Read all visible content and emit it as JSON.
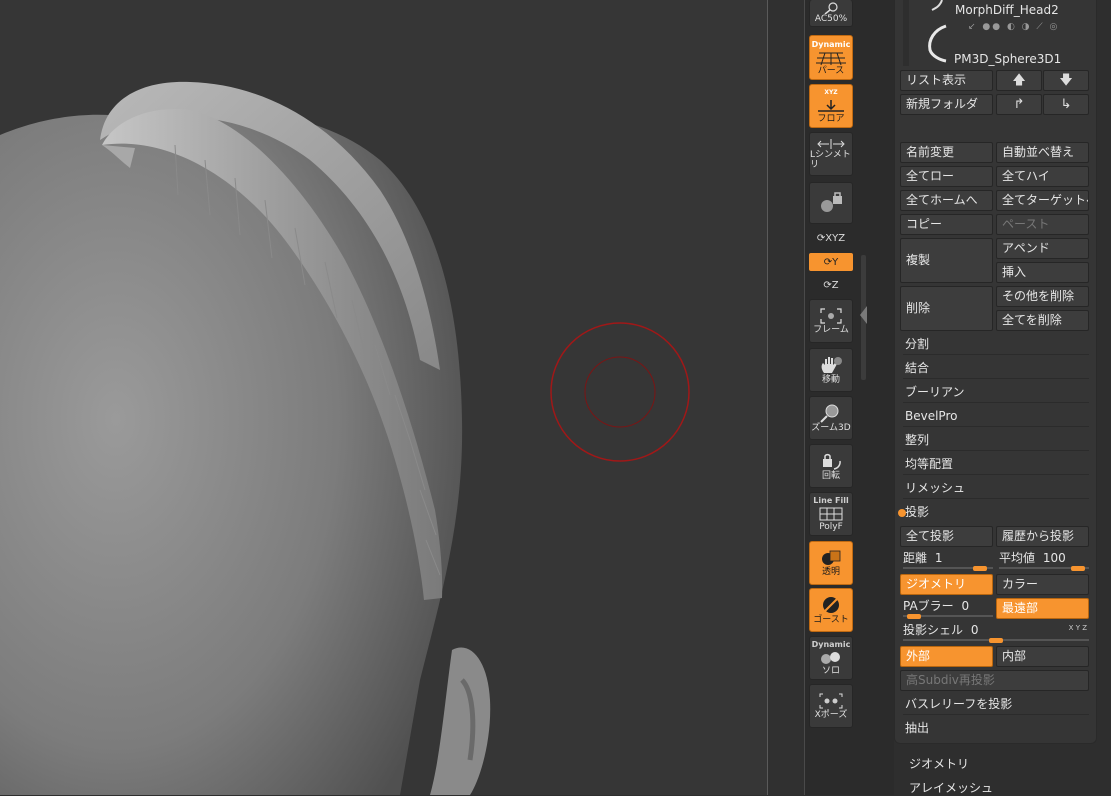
{
  "toolbar": {
    "ac_label": "AC50%",
    "persp_top": "Dynamic",
    "persp_label": "パース",
    "floor_top": "XYZ",
    "floor_label": "フロア",
    "symmetry_label": "Lシンメトリ",
    "xyz_label": "XYZ",
    "y_label": "Y",
    "z_label": "Z",
    "frame_label": "フレーム",
    "move_label": "移動",
    "zoom_label": "ズーム3D",
    "rotate_label": "回転",
    "polyf_top": "Line Fill",
    "polyf_label": "PolyF",
    "transp_label": "透明",
    "ghost_label": "ゴースト",
    "solo_top": "Dynamic",
    "solo_label": "ソロ",
    "xpose_label": "Xポーズ"
  },
  "subtools": {
    "item1": "MorphDiff_Head2",
    "item2": "PM3D_Sphere3D1"
  },
  "palette": {
    "list_view": "リスト表示",
    "new_folder": "新規フォルダ",
    "rename": "名前変更",
    "auto_sort": "自動並べ替え",
    "all_low": "全てロー",
    "all_high": "全てハイ",
    "all_home": "全てホームへ",
    "all_target": "全てターゲットへ",
    "copy": "コピー",
    "paste": "ペースト",
    "duplicate": "複製",
    "append": "アペンド",
    "insert": "挿入",
    "delete": "削除",
    "delete_other": "その他を削除",
    "delete_all": "全てを削除",
    "split": "分割",
    "merge": "結合",
    "boolean": "ブーリアン",
    "bevelpro": "BevelPro",
    "align": "整列",
    "distribute": "均等配置",
    "remesh": "リメッシュ",
    "project": "投影",
    "project_all": "全て投影",
    "project_history": "履歴から投影",
    "distance_label": "距離",
    "distance_value": "1",
    "distance_fraction": 0.92,
    "mean_label": "平均値",
    "mean_value": "100",
    "mean_fraction": 0.95,
    "geometry": "ジオメトリ",
    "color": "カラー",
    "pa_blur_label": "PAブラー",
    "pa_blur_value": "0",
    "pa_blur_fraction": 0.05,
    "farthest": "最遠部",
    "proj_shell_label": "投影シェル",
    "proj_shell_value": "0",
    "proj_shell_fraction": 0.5,
    "xyz_tag": "X Y Z",
    "outer": "外部",
    "inner": "内部",
    "high_subdiv": "高Subdiv再投影",
    "project_basrelief": "バスレリーフを投影",
    "extract": "抽出"
  },
  "below": {
    "geometry": "ジオメトリ",
    "array_mesh": "アレイメッシュ"
  },
  "colors": {
    "accent": "#f7942f",
    "brush_ring": "#a01818"
  }
}
